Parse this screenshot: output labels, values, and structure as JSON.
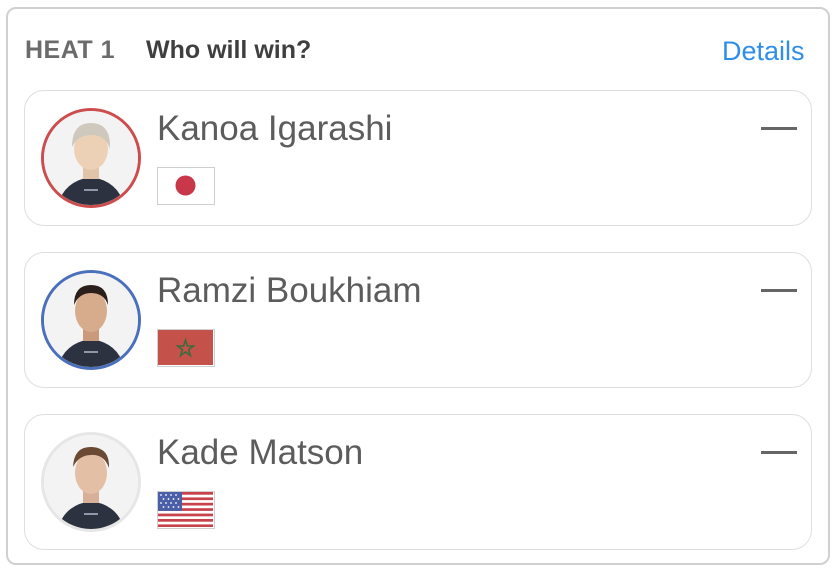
{
  "header": {
    "heat_label": "HEAT 1",
    "question": "Who will win?",
    "details_link": "Details",
    "accent_color": "#2f8ee8"
  },
  "surfers": [
    {
      "name": "Kanoa Igarashi",
      "flag": "japan-flag-icon",
      "ring_color": "#cc4d4d",
      "prediction": "—"
    },
    {
      "name": "Ramzi Boukhiam",
      "flag": "morocco-flag-icon",
      "ring_color": "#4a6fbd",
      "prediction": "—"
    },
    {
      "name": "Kade Matson",
      "flag": "usa-flag-icon",
      "ring_color": "#e6e6e6",
      "prediction": "—"
    }
  ]
}
